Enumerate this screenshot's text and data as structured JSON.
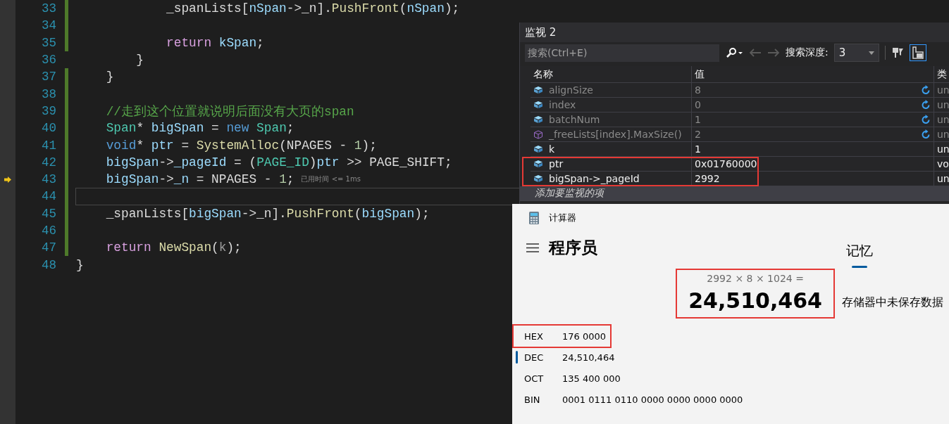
{
  "editor": {
    "lines": [
      {
        "number": "33",
        "changed": true,
        "tokens": [
          {
            "kind": "plain",
            "text": "            _spanLists["
          },
          {
            "kind": "var",
            "text": "nSpan"
          },
          {
            "kind": "plain",
            "text": "->_n]."
          },
          {
            "kind": "func",
            "text": "PushFront"
          },
          {
            "kind": "plain",
            "text": "("
          },
          {
            "kind": "var",
            "text": "nSpan"
          },
          {
            "kind": "plain",
            "text": ");"
          }
        ]
      },
      {
        "number": "34",
        "changed": true
      },
      {
        "number": "35",
        "changed": true,
        "tokens": [
          {
            "kind": "control",
            "text": "            return"
          },
          {
            "kind": "var",
            "text": " kSpan"
          },
          {
            "kind": "plain",
            "text": ";"
          }
        ]
      },
      {
        "number": "36",
        "changed": false,
        "tokens": [
          {
            "kind": "plain",
            "text": "        }"
          }
        ]
      },
      {
        "number": "37",
        "changed": true,
        "tokens": [
          {
            "kind": "plain",
            "text": "    }"
          }
        ]
      },
      {
        "number": "38",
        "changed": true
      },
      {
        "number": "39",
        "changed": true,
        "tokens": [
          {
            "kind": "comment",
            "text": "    //走到这个位置就说明后面没有大页的span"
          }
        ]
      },
      {
        "number": "40",
        "changed": true,
        "tokens": [
          {
            "kind": "type",
            "text": "    Span"
          },
          {
            "kind": "plain",
            "text": "* "
          },
          {
            "kind": "var",
            "text": "bigSpan"
          },
          {
            "kind": "plain",
            "text": " = "
          },
          {
            "kind": "keyword",
            "text": "new"
          },
          {
            "kind": "type",
            "text": " Span"
          },
          {
            "kind": "plain",
            "text": ";"
          }
        ]
      },
      {
        "number": "41",
        "changed": true,
        "tokens": [
          {
            "kind": "keyword",
            "text": "    void"
          },
          {
            "kind": "plain",
            "text": "* "
          },
          {
            "kind": "var",
            "text": "ptr"
          },
          {
            "kind": "plain",
            "text": " = "
          },
          {
            "kind": "func",
            "text": "SystemAlloc"
          },
          {
            "kind": "plain",
            "text": "(NPAGES - "
          },
          {
            "kind": "number",
            "text": "1"
          },
          {
            "kind": "plain",
            "text": ");"
          }
        ]
      },
      {
        "number": "42",
        "changed": true,
        "tokens": [
          {
            "kind": "var",
            "text": "    bigSpan"
          },
          {
            "kind": "plain",
            "text": "->"
          },
          {
            "kind": "var",
            "text": "_pageId"
          },
          {
            "kind": "plain",
            "text": " = ("
          },
          {
            "kind": "type",
            "text": "PAGE_ID"
          },
          {
            "kind": "plain",
            "text": ")"
          },
          {
            "kind": "var",
            "text": "ptr"
          },
          {
            "kind": "plain",
            "text": " >> PAGE_SHIFT;"
          }
        ]
      },
      {
        "number": "43",
        "changed": true,
        "execution_pointer": true,
        "hint": "已用时间 <= 1ms",
        "tokens": [
          {
            "kind": "var",
            "text": "    bigSpan"
          },
          {
            "kind": "plain",
            "text": "->"
          },
          {
            "kind": "var",
            "text": "_n"
          },
          {
            "kind": "plain",
            "text": " = NPAGES - "
          },
          {
            "kind": "number",
            "text": "1"
          },
          {
            "kind": "plain",
            "text": ";"
          }
        ]
      },
      {
        "number": "44",
        "changed": true,
        "current": true
      },
      {
        "number": "45",
        "changed": true,
        "tokens": [
          {
            "kind": "plain",
            "text": "    _spanLists["
          },
          {
            "kind": "var",
            "text": "bigSpan"
          },
          {
            "kind": "plain",
            "text": "->_n]."
          },
          {
            "kind": "func",
            "text": "PushFront"
          },
          {
            "kind": "plain",
            "text": "("
          },
          {
            "kind": "var",
            "text": "bigSpan"
          },
          {
            "kind": "plain",
            "text": ");"
          }
        ]
      },
      {
        "number": "46",
        "changed": true
      },
      {
        "number": "47",
        "changed": true,
        "tokens": [
          {
            "kind": "control",
            "text": "    return"
          },
          {
            "kind": "func",
            "text": " NewSpan"
          },
          {
            "kind": "plain",
            "text": "("
          },
          {
            "kind": "param",
            "text": "k"
          },
          {
            "kind": "plain",
            "text": ");"
          }
        ]
      },
      {
        "number": "48",
        "changed": false,
        "tokens": [
          {
            "kind": "plain",
            "text": "}"
          }
        ]
      }
    ]
  },
  "watch": {
    "title": "监视 2",
    "search": {
      "placeholder": "搜索(Ctrl+E)"
    },
    "depth_label": "搜索深度:",
    "depth": "3",
    "columns": [
      "名称",
      "值",
      "类"
    ],
    "rows": [
      {
        "kind": "variable",
        "name": "alignSize",
        "value": "8",
        "type": "un",
        "stale": true,
        "highlighted": false
      },
      {
        "kind": "variable",
        "name": "index",
        "value": "0",
        "type": "un",
        "stale": true,
        "highlighted": false
      },
      {
        "kind": "variable",
        "name": "batchNum",
        "value": "1",
        "type": "un",
        "stale": true,
        "highlighted": false
      },
      {
        "kind": "method",
        "name": "_freeLists[index].MaxSize()",
        "value": "2",
        "type": "un",
        "stale": true,
        "highlighted": false
      },
      {
        "kind": "variable",
        "name": "k",
        "value": "1",
        "type": "un",
        "stale": false,
        "highlighted": false
      },
      {
        "kind": "variable",
        "name": "ptr",
        "value": "0x01760000",
        "type": "vo",
        "stale": false,
        "highlighted": true
      },
      {
        "kind": "variable",
        "name": "bigSpan->_pageId",
        "value": "2992",
        "type": "un",
        "stale": false,
        "highlighted": true
      }
    ],
    "add_item": "添加要监视的项"
  },
  "calculator": {
    "title": "计算器",
    "mode": "程序员",
    "memory_tab": {
      "label": "记忆",
      "selected": true
    },
    "expression": "2992 × 8 × 1024 =",
    "result": "24,510,464",
    "result_highlighted": true,
    "memory_message": "存储器中未保存数据",
    "radix": [
      {
        "label": "HEX",
        "value": "176 0000",
        "selected": false,
        "highlighted": true
      },
      {
        "label": "DEC",
        "value": "24,510,464",
        "selected": true,
        "highlighted": false
      },
      {
        "label": "OCT",
        "value": "135 400 000",
        "selected": false,
        "highlighted": false
      },
      {
        "label": "BIN",
        "value": "0001 0111 0110 0000 0000 0000 0000",
        "selected": false,
        "highlighted": false
      }
    ]
  }
}
